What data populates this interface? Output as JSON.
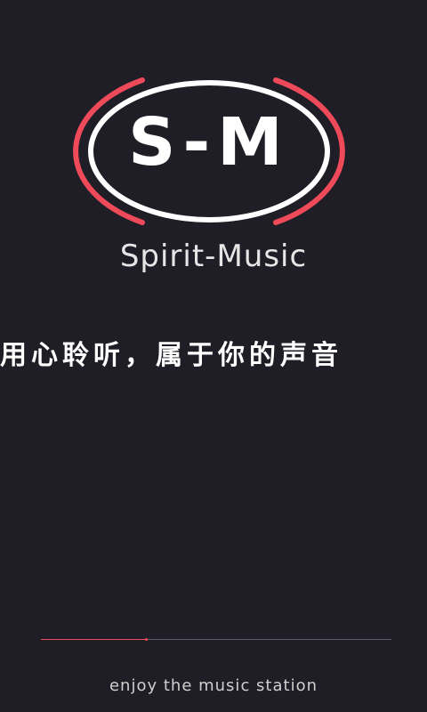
{
  "logo": {
    "text": "S-M",
    "ring_color": "#ffffff",
    "arc_color": "#ef4a5a",
    "icon": "sm-logo-icon"
  },
  "app_name": "Spirit-Music",
  "slogan": "用心聆听，属于你的声音",
  "loading": {
    "progress": 0.3,
    "fill_color": "#ef4a5a",
    "track_color": "#5c5c66"
  },
  "tagline": "enjoy the music station",
  "colors": {
    "background": "#1f1e26",
    "accent": "#ef4a5a"
  }
}
